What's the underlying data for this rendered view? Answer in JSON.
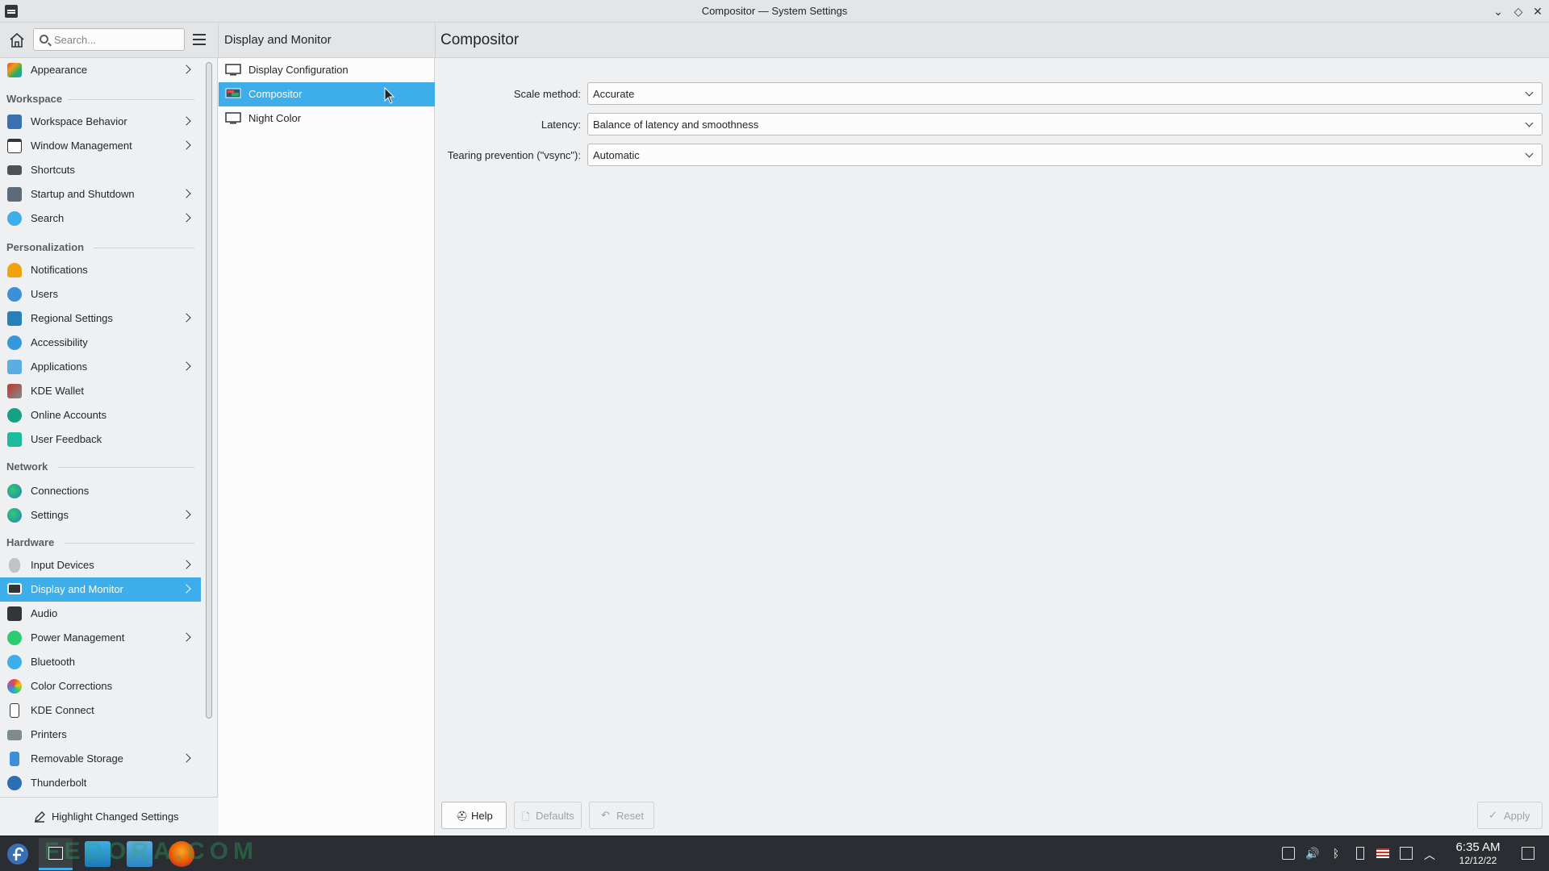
{
  "window": {
    "title": "Compositor — System Settings",
    "controls": [
      "minimize-icon",
      "maximize-icon",
      "close-icon"
    ]
  },
  "search": {
    "placeholder": "Search..."
  },
  "header": {
    "section_title": "Display and Monitor",
    "page_title": "Compositor"
  },
  "sidebar": {
    "items": [
      {
        "label": "Appearance",
        "icon": "appearance-icon",
        "chevron": true
      },
      {
        "label": "Workspace Behavior",
        "icon": "workspace-behavior-icon",
        "chevron": true
      },
      {
        "label": "Window Management",
        "icon": "window-management-icon",
        "chevron": true
      },
      {
        "label": "Shortcuts",
        "icon": "keyboard-icon",
        "chevron": false
      },
      {
        "label": "Startup and Shutdown",
        "icon": "startup-icon",
        "chevron": true
      },
      {
        "label": "Search",
        "icon": "search-icon",
        "chevron": true
      },
      {
        "label": "Notifications",
        "icon": "bell-icon",
        "chevron": false
      },
      {
        "label": "Users",
        "icon": "users-icon",
        "chevron": false
      },
      {
        "label": "Regional Settings",
        "icon": "regional-icon",
        "chevron": true
      },
      {
        "label": "Accessibility",
        "icon": "accessibility-icon",
        "chevron": false
      },
      {
        "label": "Applications",
        "icon": "applications-icon",
        "chevron": true
      },
      {
        "label": "KDE Wallet",
        "icon": "wallet-icon",
        "chevron": false
      },
      {
        "label": "Online Accounts",
        "icon": "online-accounts-icon",
        "chevron": false
      },
      {
        "label": "User Feedback",
        "icon": "feedback-icon",
        "chevron": false
      },
      {
        "label": "Connections",
        "icon": "globe-icon",
        "chevron": false
      },
      {
        "label": "Settings",
        "icon": "network-settings-icon",
        "chevron": true
      },
      {
        "label": "Input Devices",
        "icon": "mouse-icon",
        "chevron": true
      },
      {
        "label": "Display and Monitor",
        "icon": "monitor-icon",
        "chevron": true,
        "selected": true
      },
      {
        "label": "Audio",
        "icon": "speaker-icon",
        "chevron": false
      },
      {
        "label": "Power Management",
        "icon": "power-icon",
        "chevron": true
      },
      {
        "label": "Bluetooth",
        "icon": "bluetooth-icon",
        "chevron": false
      },
      {
        "label": "Color Corrections",
        "icon": "color-icon",
        "chevron": false
      },
      {
        "label": "KDE Connect",
        "icon": "phone-icon",
        "chevron": false
      },
      {
        "label": "Printers",
        "icon": "printer-icon",
        "chevron": false
      },
      {
        "label": "Removable Storage",
        "icon": "usb-icon",
        "chevron": true
      },
      {
        "label": "Thunderbolt",
        "icon": "thunderbolt-icon",
        "chevron": false
      }
    ],
    "headers": [
      "Workspace",
      "Personalization",
      "Network",
      "Hardware"
    ],
    "footer_label": "Highlight Changed Settings"
  },
  "midlist": {
    "items": [
      {
        "label": "Display Configuration",
        "icon": "monitor-icon"
      },
      {
        "label": "Compositor",
        "icon": "compositor-icon",
        "selected": true
      },
      {
        "label": "Night Color",
        "icon": "monitor-icon"
      }
    ]
  },
  "form": {
    "scale_method": {
      "label": "Scale method:",
      "value": "Accurate"
    },
    "latency": {
      "label": "Latency:",
      "value": "Balance of latency and smoothness"
    },
    "tearing": {
      "label": "Tearing prevention (\"vsync\"):",
      "value": "Automatic"
    }
  },
  "buttons": {
    "help": "Help",
    "defaults": "Defaults",
    "reset": "Reset",
    "apply": "Apply"
  },
  "taskbar": {
    "watermark": "FEDORA.COM",
    "time": "6:35 AM",
    "date": "12/12/22"
  },
  "colors": {
    "accent": "#3daee9",
    "taskbar": "#2a2e32",
    "window_bg": "#eff0f1"
  }
}
